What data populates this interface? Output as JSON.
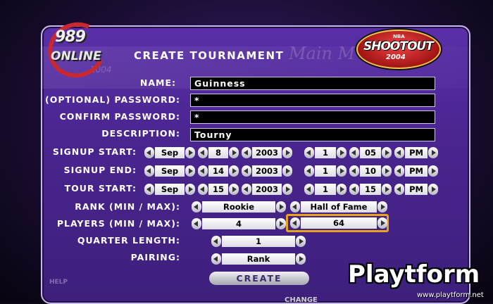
{
  "header": {
    "title": "CREATE TOURNAMENT",
    "ghost_text": "Main M",
    "logo_989_num": "989",
    "logo_989_online": "ONLINE",
    "logo_989_year": "2004",
    "shootout_nba": "NBA",
    "shootout_name": "SHOOTOUT",
    "shootout_year": "2004"
  },
  "form": {
    "name": {
      "label": "NAME:",
      "value": "Guinness"
    },
    "password": {
      "label": "(OPTIONAL) PASSWORD:",
      "value": "*"
    },
    "confirm": {
      "label": "CONFIRM PASSWORD:",
      "value": "*"
    },
    "description": {
      "label": "DESCRIPTION:",
      "value": "Tourny"
    },
    "signup_start": {
      "label": "SIGNUP START:",
      "month": "Sep",
      "day": "8",
      "year": "2003",
      "hour": "1",
      "minute": "05",
      "ampm": "PM"
    },
    "signup_end": {
      "label": "SIGNUP END:",
      "month": "Sep",
      "day": "14",
      "year": "2003",
      "hour": "1",
      "minute": "10",
      "ampm": "PM"
    },
    "tour_start": {
      "label": "TOUR START:",
      "month": "Sep",
      "day": "15",
      "year": "2003",
      "hour": "1",
      "minute": "15",
      "ampm": "PM"
    },
    "rank": {
      "label": "RANK (MIN / MAX):",
      "min": "Rookie",
      "max": "Hall of Fame"
    },
    "players": {
      "label": "PLAYERS (MIN / MAX):",
      "min": "4",
      "max": "64"
    },
    "quarter": {
      "label": "QUARTER LENGTH:",
      "value": "1"
    },
    "pairing": {
      "label": "PAIRING:",
      "value": "Rank"
    }
  },
  "buttons": {
    "create": "CREATE"
  },
  "footer": {
    "help": "HELP",
    "change": "CHANGE"
  },
  "watermark": {
    "word": "Playtform",
    "url": "www.playtform.net"
  },
  "colors": {
    "panel": "#4a2590",
    "highlight": "#e8a21c",
    "logo_red": "#c8282e"
  }
}
